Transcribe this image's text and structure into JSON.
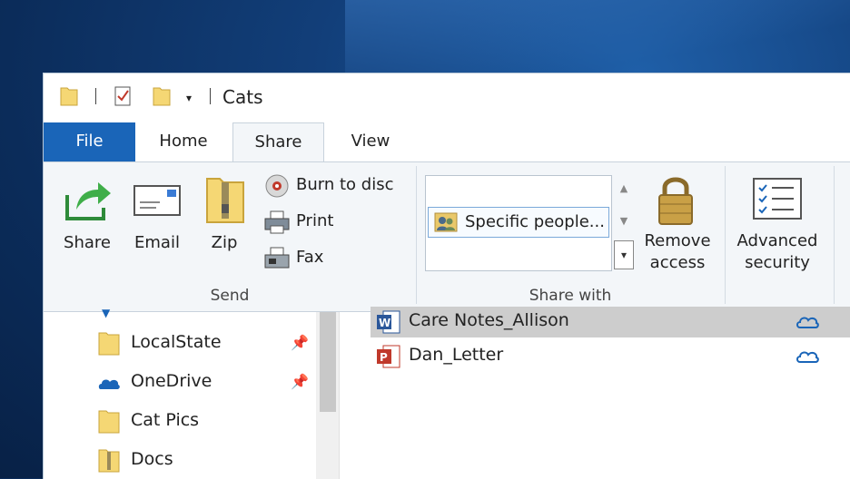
{
  "window": {
    "title": "Cats"
  },
  "tabs": {
    "file": "File",
    "home": "Home",
    "share": "Share",
    "view": "View"
  },
  "ribbon": {
    "send": {
      "group_label": "Send",
      "share": "Share",
      "email": "Email",
      "zip": "Zip",
      "burn": "Burn to disc",
      "print": "Print",
      "fax": "Fax"
    },
    "share_with": {
      "group_label": "Share with",
      "item": "Specific people...",
      "remove_line1": "Remove",
      "remove_line2": "access"
    },
    "advanced": {
      "line1": "Advanced",
      "line2": "security"
    }
  },
  "nav": {
    "items": [
      {
        "label": "LocalState",
        "pinned": true
      },
      {
        "label": "OneDrive",
        "pinned": true
      },
      {
        "label": "Cat Pics",
        "pinned": false
      },
      {
        "label": "Docs",
        "pinned": false
      }
    ]
  },
  "files": [
    {
      "name": "Care Notes_Allison",
      "type": "word-document-icon",
      "selected": true
    },
    {
      "name": "Dan_Letter",
      "type": "powerpoint-icon",
      "selected": false
    }
  ],
  "colors": {
    "accent": "#1a65b8",
    "ribbon_bg": "#f3f6f9",
    "selection": "#cdcdcd"
  }
}
